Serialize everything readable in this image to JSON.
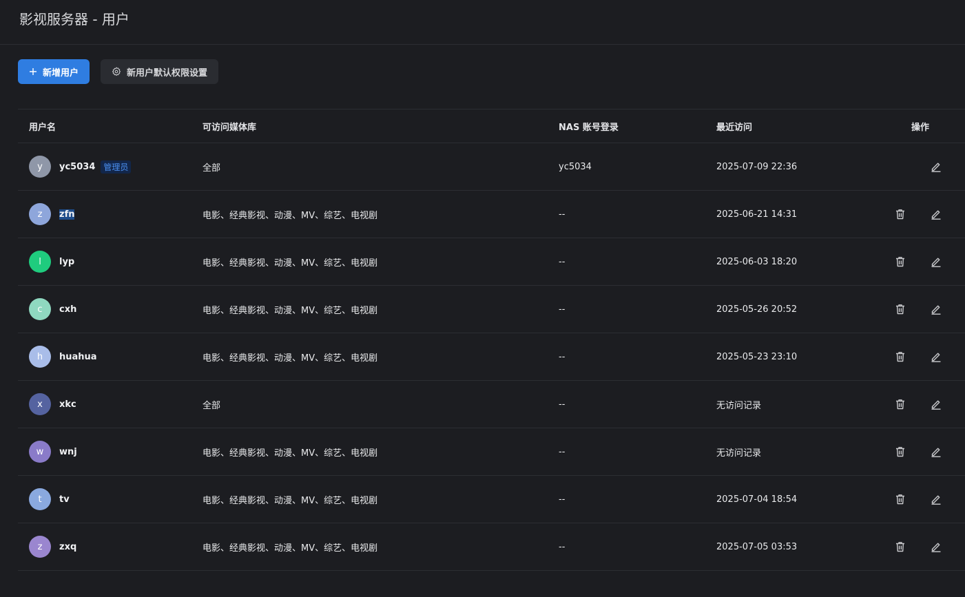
{
  "page": {
    "title": "影视服务器 - 用户"
  },
  "toolbar": {
    "add_user_label": "新增用户",
    "default_perm_label": "新用户默认权限设置"
  },
  "table": {
    "headers": {
      "username": "用户名",
      "libraries": "可访问媒体库",
      "nas_login": "NAS 账号登录",
      "last_visit": "最近访问",
      "actions": "操作"
    },
    "rows": [
      {
        "initial": "y",
        "avatar_color": "#8f97a8",
        "username": "yc5034",
        "badge": "管理员",
        "libraries": "全部",
        "nas": "yc5034",
        "last_visit": "2025-07-09 22:36",
        "deletable": false
      },
      {
        "initial": "z",
        "avatar_color": "#8ea6db",
        "username": "zfn",
        "badge": "",
        "libraries": "电影、经典影视、动漫、MV、综艺、电视剧",
        "nas": "--",
        "last_visit": "2025-06-21 14:31",
        "deletable": true,
        "selected": true
      },
      {
        "initial": "l",
        "avatar_color": "#1fcc7e",
        "username": "lyp",
        "badge": "",
        "libraries": "电影、经典影视、动漫、MV、综艺、电视剧",
        "nas": "--",
        "last_visit": "2025-06-03 18:20",
        "deletable": true
      },
      {
        "initial": "c",
        "avatar_color": "#8fd8c0",
        "username": "cxh",
        "badge": "",
        "libraries": "电影、经典影视、动漫、MV、综艺、电视剧",
        "nas": "--",
        "last_visit": "2025-05-26 20:52",
        "deletable": true
      },
      {
        "initial": "h",
        "avatar_color": "#a9bde9",
        "username": "huahua",
        "badge": "",
        "libraries": "电影、经典影视、动漫、MV、综艺、电视剧",
        "nas": "--",
        "last_visit": "2025-05-23 23:10",
        "deletable": true
      },
      {
        "initial": "x",
        "avatar_color": "#5563a0",
        "username": "xkc",
        "badge": "",
        "libraries": "全部",
        "nas": "--",
        "last_visit": "无访问记录",
        "deletable": true
      },
      {
        "initial": "w",
        "avatar_color": "#8a7bc9",
        "username": "wnj",
        "badge": "",
        "libraries": "电影、经典影视、动漫、MV、综艺、电视剧",
        "nas": "--",
        "last_visit": "无访问记录",
        "deletable": true
      },
      {
        "initial": "t",
        "avatar_color": "#8aa9df",
        "username": "tv",
        "badge": "",
        "libraries": "电影、经典影视、动漫、MV、综艺、电视剧",
        "nas": "--",
        "last_visit": "2025-07-04 18:54",
        "deletable": true
      },
      {
        "initial": "z",
        "avatar_color": "#9a86cf",
        "username": "zxq",
        "badge": "",
        "libraries": "电影、经典影视、动漫、MV、综艺、电视剧",
        "nas": "--",
        "last_visit": "2025-07-05 03:53",
        "deletable": true
      }
    ]
  },
  "icons": {
    "add": "plus-icon",
    "settings": "gear-icon",
    "delete": "trash-icon",
    "edit": "pencil-icon"
  }
}
